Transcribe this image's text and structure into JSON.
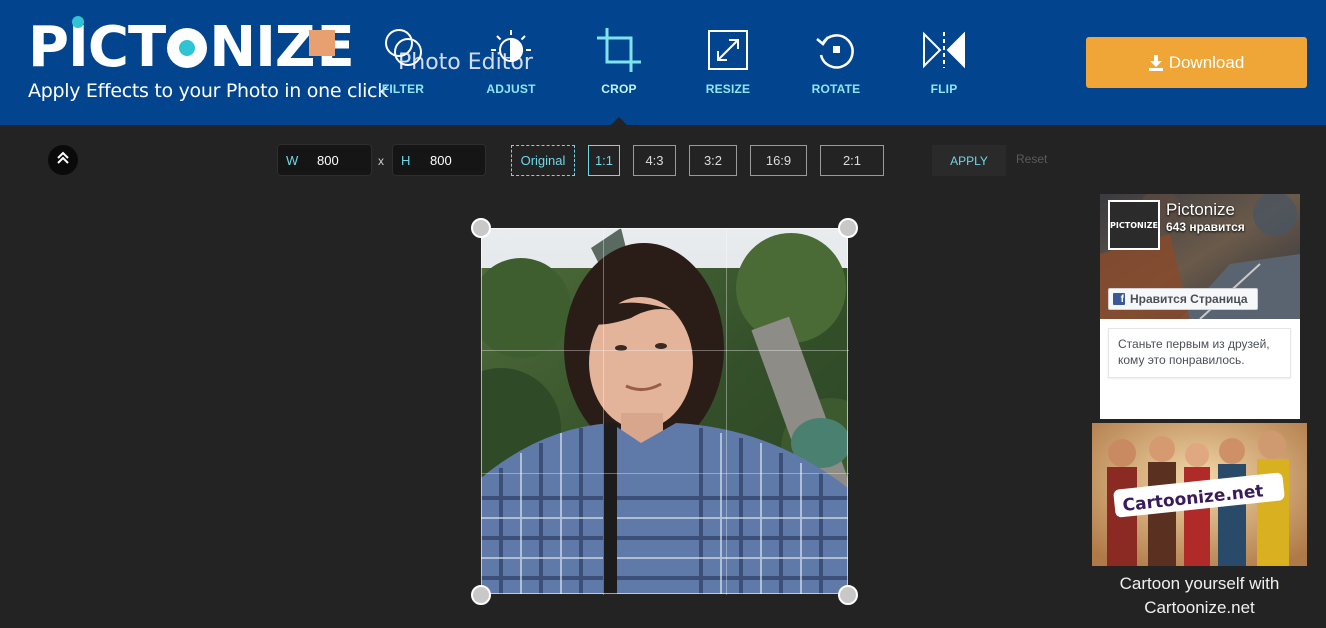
{
  "header": {
    "logo_text": "PICTONIZE",
    "tagline": "Apply Effects to your Photo in one click",
    "ghost_title": "Photo Editor",
    "download_label": "Download"
  },
  "tools": [
    {
      "label": "FILTER",
      "icon": "filter-icon"
    },
    {
      "label": "ADJUST",
      "icon": "adjust-icon"
    },
    {
      "label": "CROP",
      "icon": "crop-icon",
      "active": true
    },
    {
      "label": "RESIZE",
      "icon": "resize-icon"
    },
    {
      "label": "ROTATE",
      "icon": "rotate-icon"
    },
    {
      "label": "FLIP",
      "icon": "flip-icon"
    }
  ],
  "crop_toolbar": {
    "width_label": "W",
    "width_value": "800",
    "separator": "x",
    "height_label": "H",
    "height_value": "800",
    "ratios": [
      "Original",
      "1:1",
      "4:3",
      "3:2",
      "16:9",
      "2:1"
    ],
    "selected_ratio": "1:1",
    "apply_label": "APPLY",
    "reset_label": "Reset"
  },
  "facebook": {
    "page_name": "Pictonize",
    "likes": "643 нравится",
    "like_button": "Нравится Страница",
    "friends_text_line1": "Станьте первым из друзей,",
    "friends_text_line2": "кому это понравилось.",
    "thumb_text": "PICTONIZE"
  },
  "ad": {
    "banner_text": "Cartoonize.net",
    "caption_line1": "Cartoon yourself with",
    "caption_line2": "Cartoonize.net"
  },
  "colors": {
    "header_bg": "#03448f",
    "accent": "#6fd7e5",
    "download_bg": "#f0a637",
    "canvas_bg": "#232323"
  }
}
